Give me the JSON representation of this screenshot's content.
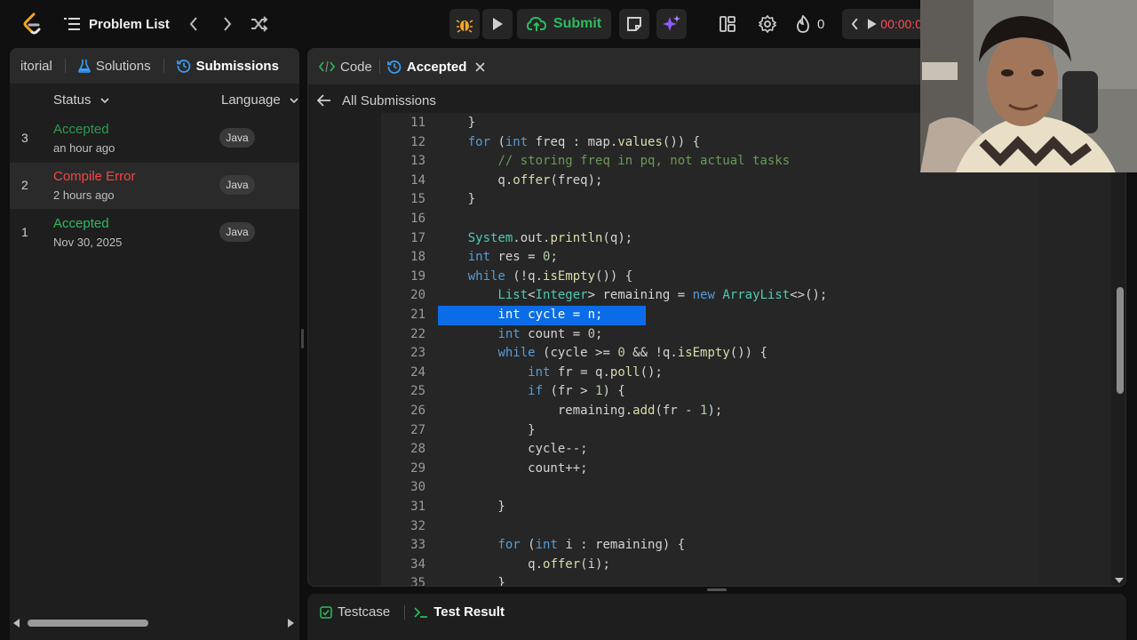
{
  "topbar": {
    "problem_list": "Problem List",
    "submit": "Submit",
    "streak_count": "0",
    "timer": "00:00:0"
  },
  "left_panel": {
    "tabs": [
      "itorial",
      "Solutions",
      "Submissions"
    ],
    "columns": {
      "status": "Status",
      "language": "Language"
    },
    "submissions": [
      {
        "num": "3",
        "status": "Accepted",
        "time": "an hour ago",
        "language": "Java",
        "color": "#2cbb5d"
      },
      {
        "num": "2",
        "status": "Compile Error",
        "time": "2 hours ago",
        "language": "Java",
        "color": "#ef4743"
      },
      {
        "num": "1",
        "status": "Accepted",
        "time": "Nov 30, 2025",
        "language": "Java",
        "color": "#2cbb5d"
      }
    ]
  },
  "code_panel": {
    "tabs": [
      "Code",
      "Accepted"
    ],
    "back_label": "All Submissions",
    "lines": [
      {
        "n": "11",
        "i": 1,
        "t": "}"
      },
      {
        "n": "12",
        "i": 1,
        "t": "for (int freq : map.values()) {"
      },
      {
        "n": "13",
        "i": 2,
        "t": "// storing freq in pq, not actual tasks"
      },
      {
        "n": "14",
        "i": 2,
        "t": "q.offer(freq);"
      },
      {
        "n": "15",
        "i": 1,
        "t": "}"
      },
      {
        "n": "16",
        "i": 0,
        "t": ""
      },
      {
        "n": "17",
        "i": 1,
        "t": "System.out.println(q);"
      },
      {
        "n": "18",
        "i": 1,
        "t": "int res = 0;"
      },
      {
        "n": "19",
        "i": 1,
        "t": "while (!q.isEmpty()) {"
      },
      {
        "n": "20",
        "i": 2,
        "t": "List<Integer> remaining = new ArrayList<>();"
      },
      {
        "n": "21",
        "i": 2,
        "t": "int cycle = n;"
      },
      {
        "n": "22",
        "i": 2,
        "t": "int count = 0;"
      },
      {
        "n": "23",
        "i": 2,
        "t": "while (cycle >= 0 && !q.isEmpty()) {"
      },
      {
        "n": "24",
        "i": 3,
        "t": "int fr = q.poll();"
      },
      {
        "n": "25",
        "i": 3,
        "t": "if (fr > 1) {"
      },
      {
        "n": "26",
        "i": 4,
        "t": "remaining.add(fr - 1);"
      },
      {
        "n": "27",
        "i": 3,
        "t": "}"
      },
      {
        "n": "28",
        "i": 3,
        "t": "cycle--;"
      },
      {
        "n": "29",
        "i": 3,
        "t": "count++;"
      },
      {
        "n": "30",
        "i": 0,
        "t": ""
      },
      {
        "n": "31",
        "i": 2,
        "t": "}"
      },
      {
        "n": "32",
        "i": 0,
        "t": ""
      },
      {
        "n": "33",
        "i": 2,
        "t": "for (int i : remaining) {"
      },
      {
        "n": "34",
        "i": 3,
        "t": "q.offer(i);"
      },
      {
        "n": "35",
        "i": 2,
        "t": "}"
      }
    ],
    "selected_line": "21"
  },
  "bottom_panel": {
    "tabs": [
      "Testcase",
      "Test Result"
    ]
  },
  "colors": {
    "accent_green": "#2cbb5d",
    "error_red": "#ef4743",
    "selection_blue": "#0b6ce8",
    "submissions_icon": "#3b9cf5"
  }
}
